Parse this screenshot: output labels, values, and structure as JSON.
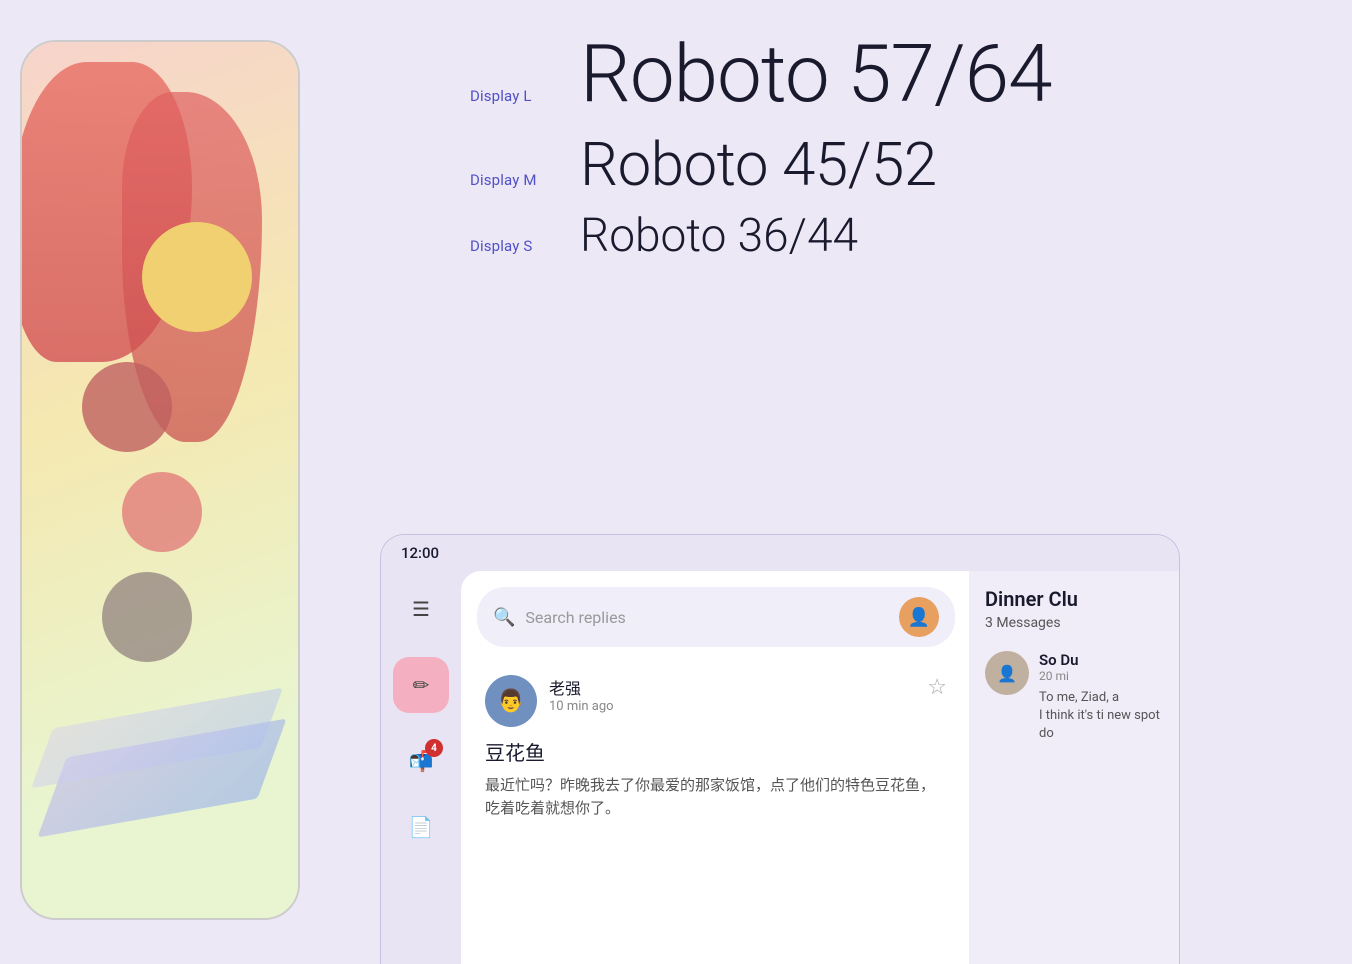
{
  "background_color": "#ede8f5",
  "phone_illustration": {
    "visible": true
  },
  "typography": {
    "rows": [
      {
        "label": "Display L",
        "text": "Roboto 57/64",
        "size_class": "display-l"
      },
      {
        "label": "Display M",
        "text": "Roboto 45/52",
        "size_class": "display-m"
      },
      {
        "label": "Display S",
        "text": "Roboto 36/44",
        "size_class": "display-s"
      }
    ]
  },
  "phone_ui": {
    "status_time": "12:00",
    "search_placeholder": "Search replies",
    "sidebar_icons": [
      {
        "name": "menu-icon",
        "symbol": "☰",
        "active": false,
        "badge": null
      },
      {
        "name": "compose-icon",
        "symbol": "✏",
        "active": true,
        "badge": null
      },
      {
        "name": "inbox-icon",
        "symbol": "🗳",
        "active": false,
        "badge": 4
      },
      {
        "name": "notes-icon",
        "symbol": "☰",
        "active": false,
        "badge": null
      }
    ],
    "message": {
      "sender_name": "老强",
      "time_ago": "10 min ago",
      "subject": "豆花鱼",
      "preview": "最近忙吗？昨晚我去了你最爱的那家饭馆，点了他们的特色豆花鱼，吃着吃着就想你了。",
      "starred": false
    },
    "right_panel": {
      "title": "Dinner Clu",
      "message_count": "3 Messages",
      "contact_name": "So Du",
      "contact_time": "20 mi",
      "contact_to": "To me, Ziad, a",
      "think_text": "I think it's ti\nnew spot do"
    }
  }
}
